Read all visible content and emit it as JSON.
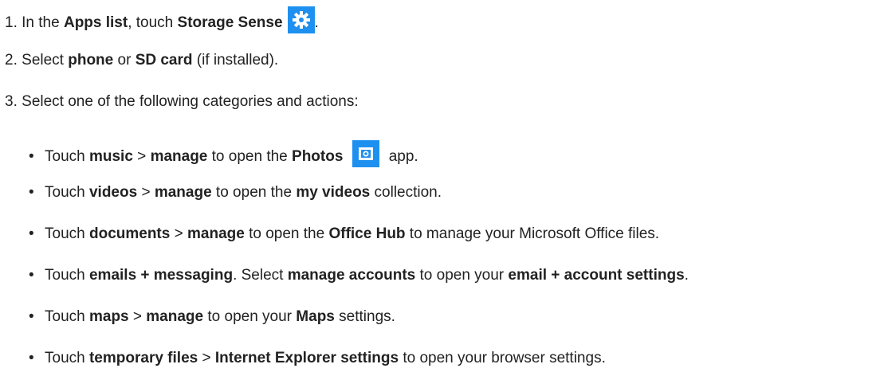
{
  "steps": [
    {
      "num": "1.",
      "t1": "In the ",
      "b1": "Apps list",
      "t2": ", touch ",
      "b2": "Storage Sense",
      "icon": "gear-icon",
      "t3": "."
    },
    {
      "num": "2.",
      "t1": "Select ",
      "b1": "phone",
      "t2": " or ",
      "b2": "SD card",
      "t3": " (if installed)."
    },
    {
      "num": "3.",
      "t1": "Select one of the following categories and actions:"
    }
  ],
  "bullets": [
    {
      "t1": "Touch ",
      "b1": "music",
      "t2": " > ",
      "b2": "manage",
      "t3": " to open the ",
      "b3": "Photos",
      "icon": "photos-icon",
      "t4": " app."
    },
    {
      "t1": "Touch ",
      "b1": "videos",
      "t2": " > ",
      "b2": "manage",
      "t3": " to open the ",
      "b3": "my videos",
      "t4": " collection."
    },
    {
      "t1": "Touch ",
      "b1": "documents",
      "t2": " > ",
      "b2": "manage",
      "t3": " to open the ",
      "b3": "Office Hub",
      "t4": " to manage your Microsoft Office files."
    },
    {
      "t1": "Touch ",
      "b1": "emails + messaging",
      "t2": ". Select ",
      "b2": "manage accounts",
      "t3": " to open your ",
      "b3": "email + account settings",
      "t4": "."
    },
    {
      "t1": "Touch ",
      "b1": "maps",
      "t2": " > ",
      "b2": "manage",
      "t3": " to open your ",
      "b3": "Maps",
      "t4": " settings."
    },
    {
      "t1": "Touch ",
      "b1": "temporary files",
      "t2": " > ",
      "b2": "Internet Explorer settings",
      "t3": " to open your browser settings."
    }
  ],
  "bullet_char": "•",
  "colors": {
    "icon_blue": "#1e90f0",
    "text": "#222222"
  }
}
